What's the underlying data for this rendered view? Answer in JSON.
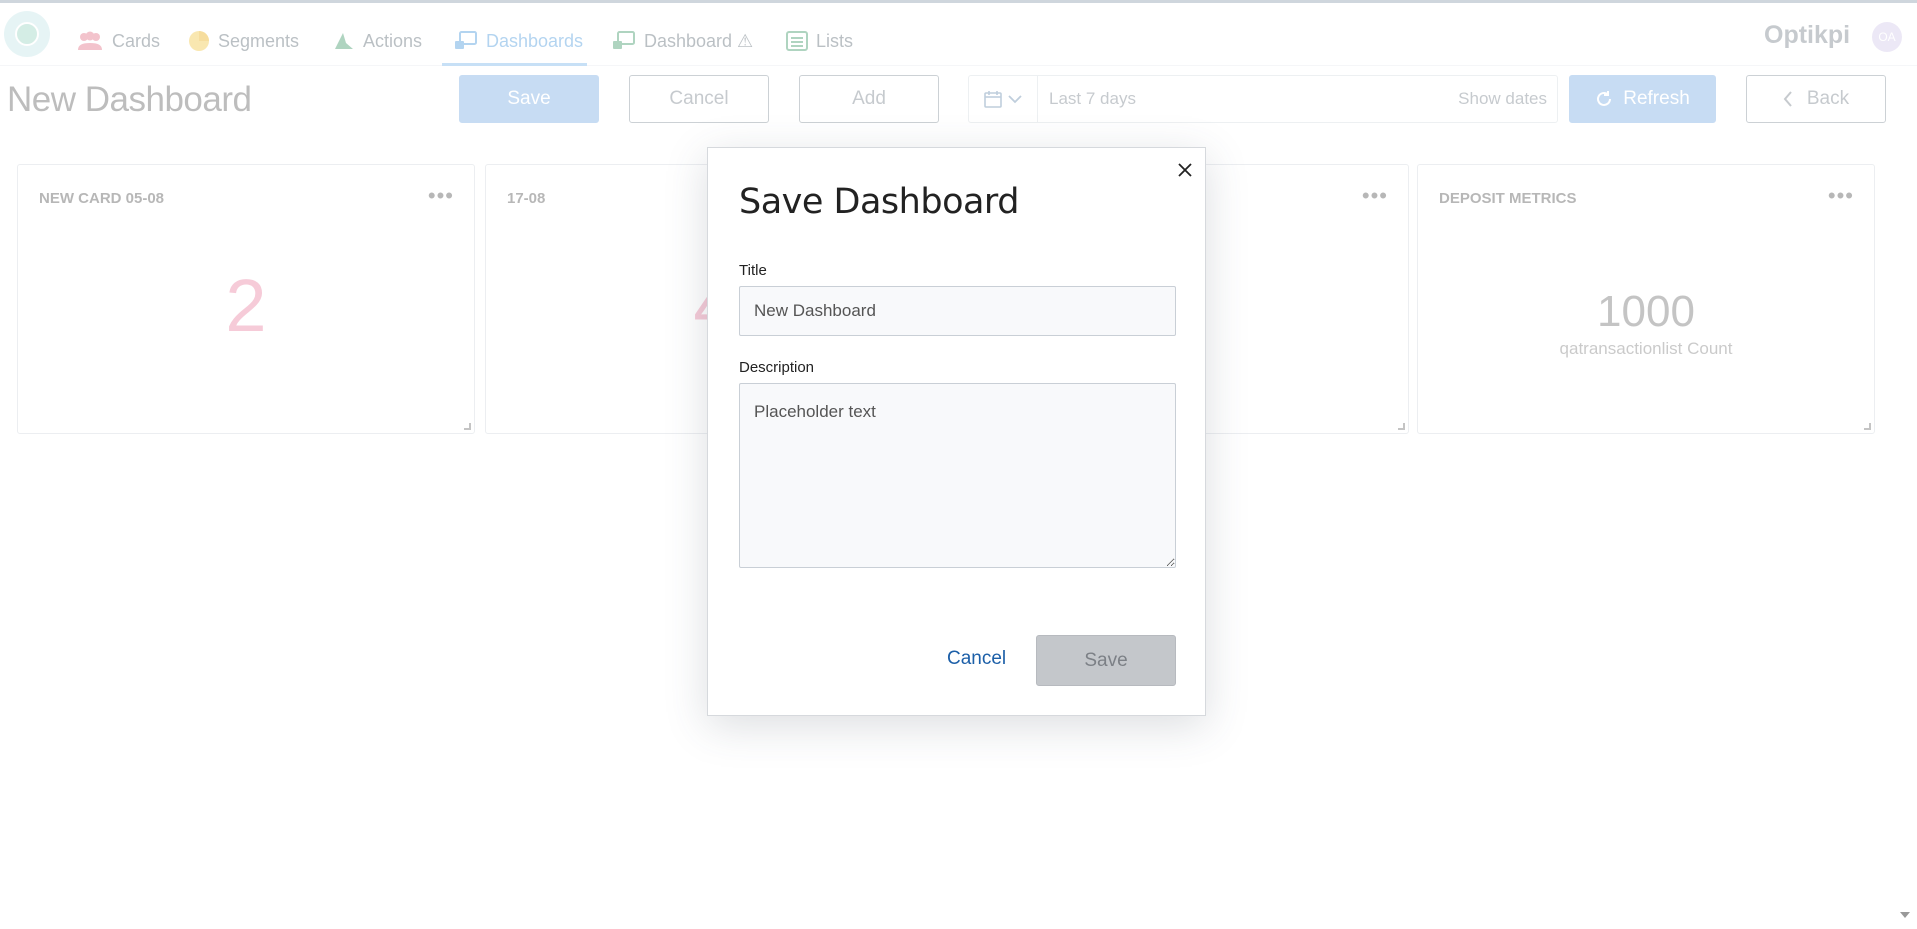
{
  "nav": {
    "items": [
      {
        "label": "Cards",
        "icon": "users-icon"
      },
      {
        "label": "Segments",
        "icon": "pie-chart-icon"
      },
      {
        "label": "Actions",
        "icon": "actions-icon"
      },
      {
        "label": "Dashboards",
        "icon": "dashboard-icon"
      },
      {
        "label": "Dashboard ⚠",
        "icon": "dashboard-icon"
      },
      {
        "label": "Lists",
        "icon": "list-icon"
      }
    ],
    "active": "Dashboards",
    "brand": "Optikpi",
    "avatar": "OA"
  },
  "page": {
    "title": "New Dashboard",
    "toolbar": {
      "save": "Save",
      "cancel": "Cancel",
      "add": "Add",
      "date_range": "Last 7 days",
      "show_dates": "Show dates",
      "refresh": "Refresh",
      "back": "Back"
    }
  },
  "cards": [
    {
      "title": "NEW CARD 05-08",
      "value": "2",
      "subtitle": ""
    },
    {
      "title": "17-08",
      "value": "4",
      "subtitle": ""
    },
    {
      "title": "",
      "value": "",
      "subtitle": ""
    },
    {
      "title": "DEPOSIT METRICS",
      "value": "1000",
      "subtitle": "qatransactionlist Count"
    }
  ],
  "modal": {
    "title": "Save Dashboard",
    "title_label": "Title",
    "title_value": "New Dashboard",
    "description_label": "Description",
    "description_value": "Placeholder text",
    "cancel": "Cancel",
    "save": "Save"
  },
  "colors": {
    "accent": "#3b8fd8",
    "card_number": "#e8789b",
    "modal_link": "#1c5fa8",
    "modal_save_disabled": "#c4c7cb"
  }
}
